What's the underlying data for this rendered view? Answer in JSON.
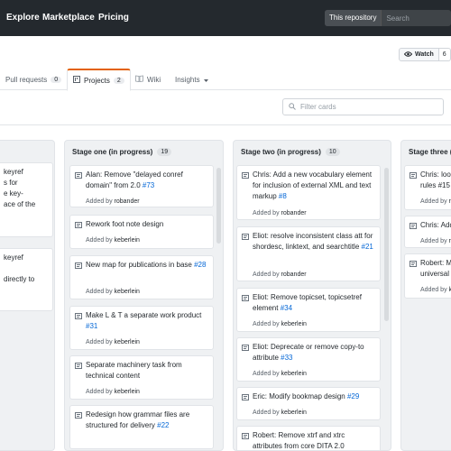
{
  "topnav": [
    "Explore",
    "Marketplace",
    "Pricing"
  ],
  "search": {
    "scope": "This repository",
    "placeholder": "Search"
  },
  "watch": {
    "label": "Watch",
    "count": "6"
  },
  "tabs": [
    {
      "label": "Pull requests",
      "count": "0"
    },
    {
      "label": "Projects",
      "count": "2"
    },
    {
      "label": "Wiki"
    },
    {
      "label": "Insights"
    }
  ],
  "filter": {
    "placeholder": "Filter cards"
  },
  "columns": [
    {
      "name": "",
      "count": "",
      "cards": [
        {
          "lines": [
            "keyref",
            "s for",
            "e key-",
            "ace of the"
          ]
        },
        {
          "lines": [
            "keyref",
            "directly to"
          ]
        }
      ]
    },
    {
      "name": "Stage one (in progress)",
      "count": "19",
      "cards": [
        {
          "title": "Alan: Remove \"delayed conref domain\" from 2.0",
          "num": "#73",
          "added_by": "robander"
        },
        {
          "title": "Rework foot note design",
          "num": "",
          "added_by": "keberlein"
        },
        {
          "title": "New map for publications in base",
          "num": "#28",
          "added_by": "keberlein"
        },
        {
          "title": "Make L & T a separate work product",
          "num": "#31",
          "added_by": "keberlein"
        },
        {
          "title": "Separate machinery task from technical content",
          "num": "",
          "added_by": "keberlein"
        },
        {
          "title": "Redesign how grammar files are structured for delivery",
          "num": "#22",
          "added_by": "keberlein"
        }
      ]
    },
    {
      "name": "Stage two (in progress)",
      "count": "10",
      "cards": [
        {
          "title": "Chris: Add a new vocabulary element for inclusion of external XML and text markup",
          "num": "#8",
          "added_by": "robander"
        },
        {
          "title": "Eliot: resolve inconsistent class att for shordesc, linktext, and searchtitle",
          "num": "#21",
          "added_by": "robander"
        },
        {
          "title": "Eliot: Remove topicset, topicsetref element",
          "num": "#34",
          "added_by": "keberlein"
        },
        {
          "title": "Eliot: Deprecate or remove copy-to attribute",
          "num": "#33",
          "added_by": "keberlein"
        },
        {
          "title": "Eric: Modify bookmap design",
          "num": "#29",
          "added_by": "keberlein"
        },
        {
          "title": "Robert: Remove xtrf and xtrc attributes from core DITA 2.0",
          "num": "",
          "added_by": ""
        }
      ]
    },
    {
      "name": "Stage three (",
      "count": "",
      "cards": [
        {
          "lines": [
            "Chris: loos",
            "rules #15"
          ],
          "added_by": "r"
        },
        {
          "lines": [
            "Chris: Add"
          ],
          "added_by": "r"
        },
        {
          "lines": [
            "Robert: M",
            "universal a"
          ],
          "added_by": "k"
        }
      ]
    }
  ],
  "added_prefix": "Added by"
}
